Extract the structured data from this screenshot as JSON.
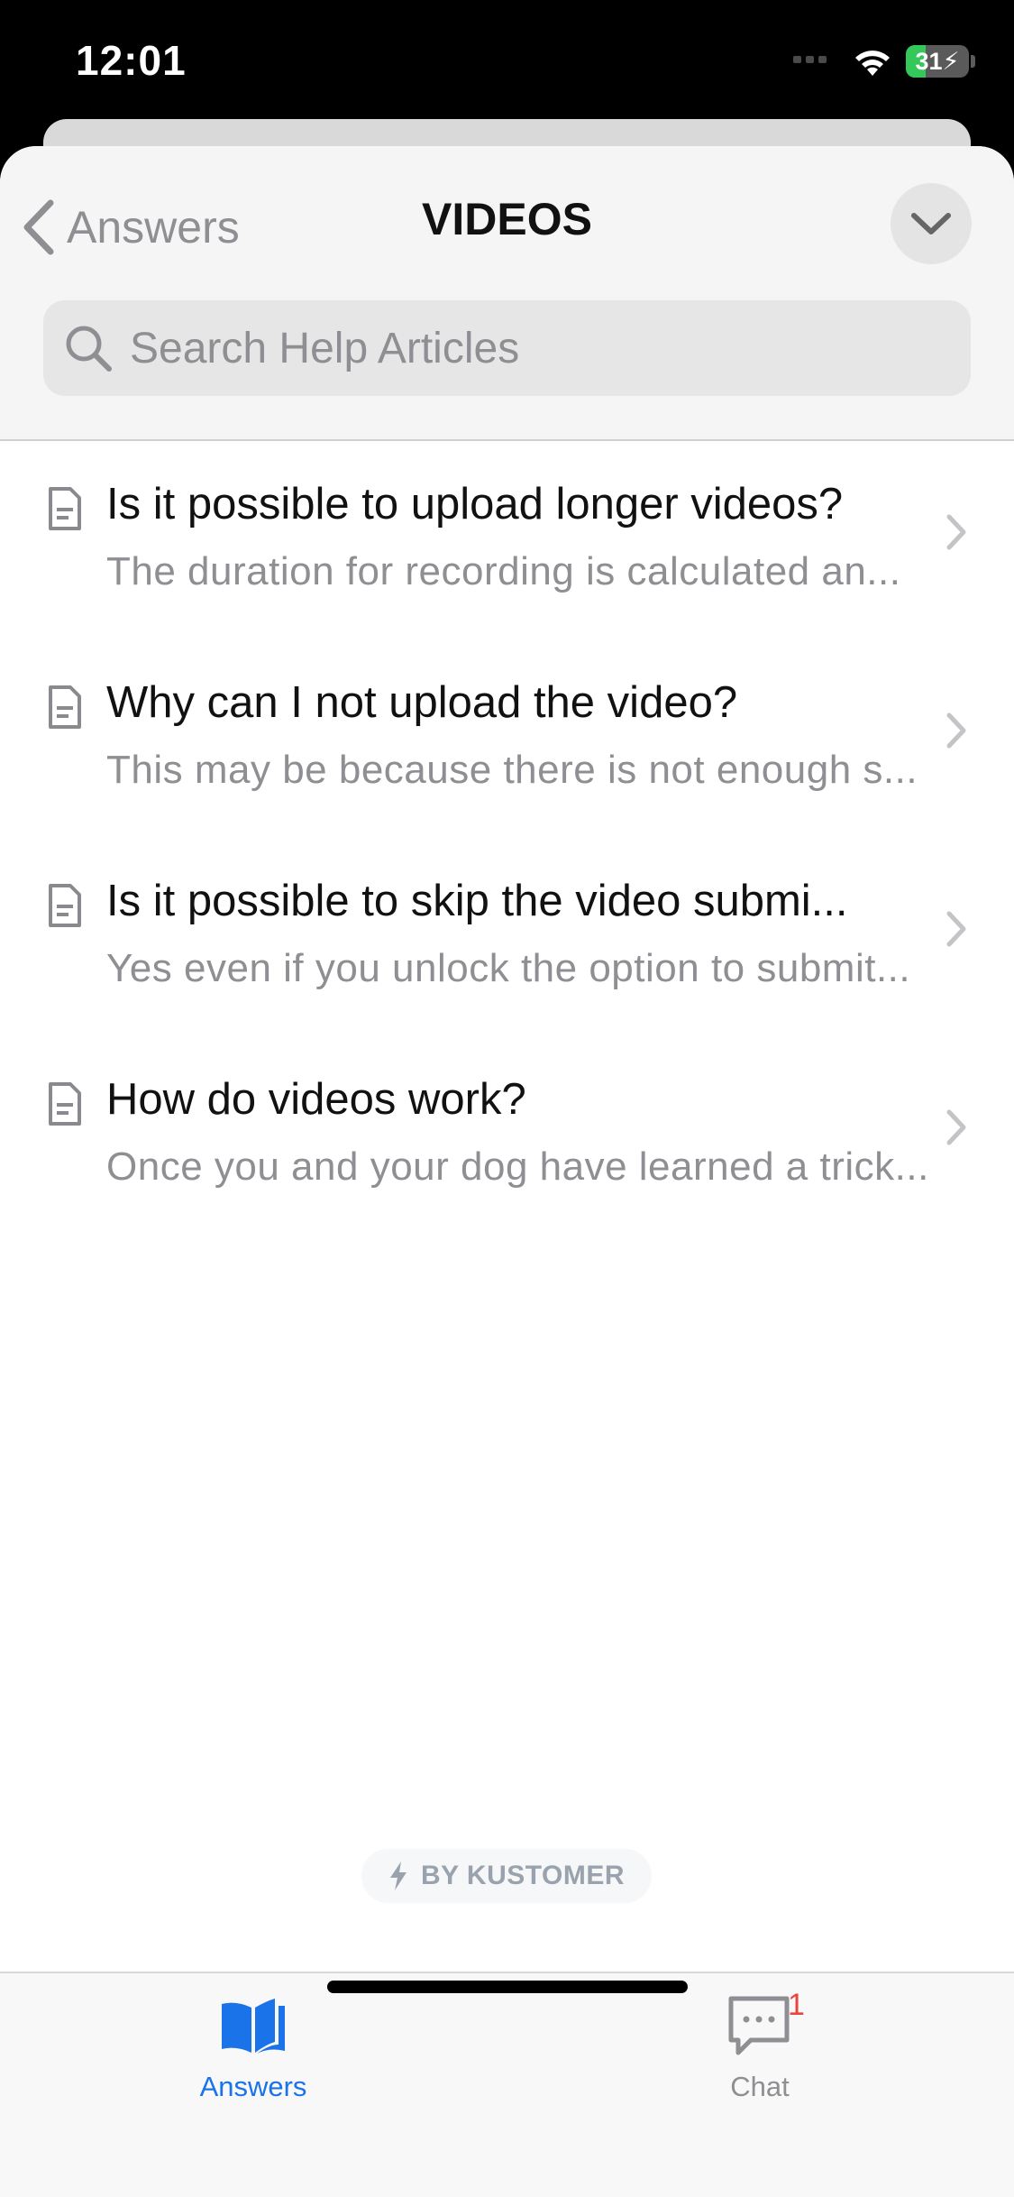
{
  "status_bar": {
    "time": "12:01",
    "battery_level": "31",
    "battery_fraction": 0.31,
    "charging": true
  },
  "header": {
    "back_label": "Answers",
    "title": "VIDEOS"
  },
  "search": {
    "placeholder": "Search Help Articles"
  },
  "articles": [
    {
      "title": "Is it possible to upload longer videos?",
      "excerpt": "The duration for recording is calculated an..."
    },
    {
      "title": "Why can I not upload the video?",
      "excerpt": "This may be because there is not enough s..."
    },
    {
      "title": "Is it possible to skip the video submi...",
      "excerpt": "Yes even if you unlock the option to submit..."
    },
    {
      "title": "How do videos work?",
      "excerpt": "Once you and your dog have learned a trick..."
    }
  ],
  "powered_by": {
    "label": "BY KUSTOMER"
  },
  "tabbar": {
    "answers_label": "Answers",
    "chat_label": "Chat",
    "chat_badge": "1"
  },
  "colors": {
    "accent": "#1a73e8",
    "badge": "#e8453c",
    "battery_green": "#34c759"
  }
}
